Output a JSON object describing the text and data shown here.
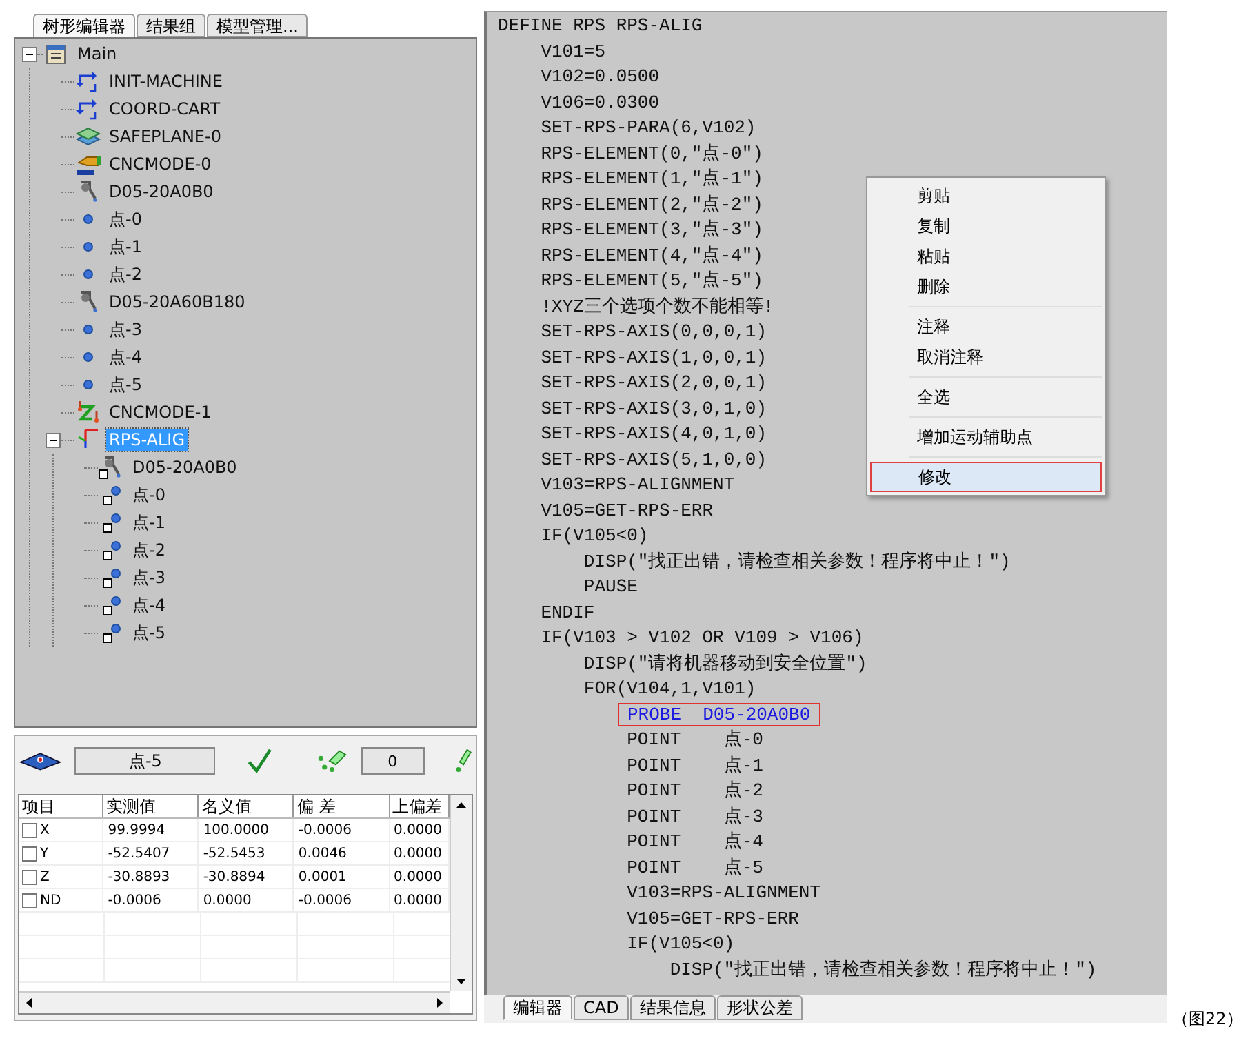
{
  "left_tabs": [
    {
      "label": "树形编辑器",
      "selected": true
    },
    {
      "label": "结果组",
      "selected": false
    },
    {
      "label": "模型管理...",
      "selected": false
    }
  ],
  "tree": [
    {
      "label": "Main",
      "kind": "program",
      "expanded": true,
      "selected": false,
      "children": [
        {
          "label": "INIT-MACHINE",
          "kind": "coord",
          "selected": false
        },
        {
          "label": "COORD-CART",
          "kind": "coord",
          "selected": false
        },
        {
          "label": "SAFEPLANE-0",
          "kind": "safeplane",
          "selected": false
        },
        {
          "label": "CNCMODE-0",
          "kind": "manual",
          "selected": false
        },
        {
          "label": "D05-20A0B0",
          "kind": "probe",
          "selected": false
        },
        {
          "label": "点-0",
          "kind": "point",
          "selected": false
        },
        {
          "label": "点-1",
          "kind": "point",
          "selected": false
        },
        {
          "label": "点-2",
          "kind": "point",
          "selected": false
        },
        {
          "label": "D05-20A60B180",
          "kind": "probe",
          "selected": false
        },
        {
          "label": "点-3",
          "kind": "point",
          "selected": false
        },
        {
          "label": "点-4",
          "kind": "point",
          "selected": false
        },
        {
          "label": "点-5",
          "kind": "point",
          "selected": false
        },
        {
          "label": "CNCMODE-1",
          "kind": "auto",
          "selected": false
        },
        {
          "label": "RPS-ALIG",
          "kind": "rps",
          "expanded": true,
          "selected": true,
          "children": [
            {
              "label": "D05-20A0B0",
              "kind": "probe-link",
              "selected": false
            },
            {
              "label": "点-0",
              "kind": "point-link",
              "selected": false
            },
            {
              "label": "点-1",
              "kind": "point-link",
              "selected": false
            },
            {
              "label": "点-2",
              "kind": "point-link",
              "selected": false
            },
            {
              "label": "点-3",
              "kind": "point-link",
              "selected": false
            },
            {
              "label": "点-4",
              "kind": "point-link",
              "selected": false
            },
            {
              "label": "点-5",
              "kind": "point-link",
              "selected": false
            }
          ]
        }
      ]
    }
  ],
  "feature_bar": {
    "feature": "点-5",
    "count": "0"
  },
  "table": {
    "columns": [
      "项目",
      "实测值",
      "名义值",
      "偏 差",
      "上偏差"
    ],
    "rows": [
      {
        "checked": false,
        "cells": [
          "X",
          "99.9994",
          "100.0000",
          "-0.0006",
          "0.0000"
        ]
      },
      {
        "checked": false,
        "cells": [
          "Y",
          "-52.5407",
          "-52.5453",
          "0.0046",
          "0.0000"
        ]
      },
      {
        "checked": false,
        "cells": [
          "Z",
          "-30.8893",
          "-30.8894",
          "0.0001",
          "0.0000"
        ]
      },
      {
        "checked": false,
        "cells": [
          "ND",
          "-0.0006",
          "0.0000",
          "-0.0006",
          "0.0000"
        ]
      }
    ]
  },
  "code": [
    {
      "text": "DEFINE RPS RPS-ALIG",
      "kind": "plain"
    },
    {
      "text": "    V101=5",
      "kind": "plain"
    },
    {
      "text": "    V102=0.0500",
      "kind": "plain"
    },
    {
      "text": "    V106=0.0300",
      "kind": "plain"
    },
    {
      "text": "    SET-RPS-PARA(6,V102)",
      "kind": "plain"
    },
    {
      "text": "    RPS-ELEMENT(0,″点-0″)",
      "kind": "plain"
    },
    {
      "text": "    RPS-ELEMENT(1,″点-1″)",
      "kind": "plain"
    },
    {
      "text": "    RPS-ELEMENT(2,″点-2″)",
      "kind": "plain"
    },
    {
      "text": "    RPS-ELEMENT(3,″点-3″)",
      "kind": "plain"
    },
    {
      "text": "    RPS-ELEMENT(4,″点-4″)",
      "kind": "plain"
    },
    {
      "text": "    RPS-ELEMENT(5,″点-5″)",
      "kind": "plain"
    },
    {
      "text": "    !XYZ三个选项个数不能相等!",
      "kind": "plain"
    },
    {
      "text": "    SET-RPS-AXIS(0,0,0,1)",
      "kind": "plain"
    },
    {
      "text": "    SET-RPS-AXIS(1,0,0,1)",
      "kind": "plain"
    },
    {
      "text": "    SET-RPS-AXIS(2,0,0,1)",
      "kind": "plain"
    },
    {
      "text": "    SET-RPS-AXIS(3,0,1,0)",
      "kind": "plain"
    },
    {
      "text": "    SET-RPS-AXIS(4,0,1,0)",
      "kind": "plain"
    },
    {
      "text": "    SET-RPS-AXIS(5,1,0,0)",
      "kind": "plain"
    },
    {
      "text": "    V103=RPS-ALIGNMENT",
      "kind": "plain"
    },
    {
      "text": "    V105=GET-RPS-ERR",
      "kind": "plain"
    },
    {
      "text": "    IF(V105<0)",
      "kind": "plain"
    },
    {
      "text": "        DISP(″找正出错，请检查相关参数！程序将中止！″)",
      "kind": "plain"
    },
    {
      "text": "        PAUSE",
      "kind": "plain"
    },
    {
      "text": "    ENDIF",
      "kind": "plain"
    },
    {
      "text": "    IF(V103 > V102 OR V109 > V106)",
      "kind": "plain"
    },
    {
      "text": "        DISP(″请将机器移动到安全位置″)",
      "kind": "plain"
    },
    {
      "text": "        FOR(V104,1,V101)",
      "kind": "plain"
    },
    {
      "text": "PROBE  D05-20A0B0",
      "kind": "highlight"
    },
    {
      "text": "            POINT    点-0",
      "kind": "plain"
    },
    {
      "text": "            POINT    点-1",
      "kind": "plain"
    },
    {
      "text": "            POINT    点-2",
      "kind": "plain"
    },
    {
      "text": "            POINT    点-3",
      "kind": "plain"
    },
    {
      "text": "            POINT    点-4",
      "kind": "plain"
    },
    {
      "text": "            POINT    点-5",
      "kind": "plain"
    },
    {
      "text": "            V103=RPS-ALIGNMENT",
      "kind": "plain"
    },
    {
      "text": "            V105=GET-RPS-ERR",
      "kind": "plain"
    },
    {
      "text": "            IF(V105<0)",
      "kind": "plain"
    },
    {
      "text": "                DISP(″找正出错，请检查相关参数！程序将中止！″)",
      "kind": "plain"
    }
  ],
  "context_menu": [
    [
      {
        "label": "剪贴",
        "selected": false
      },
      {
        "label": "复制",
        "selected": false
      },
      {
        "label": "粘贴",
        "selected": false
      },
      {
        "label": "删除",
        "selected": false
      }
    ],
    [
      {
        "label": "注释",
        "selected": false
      },
      {
        "label": "取消注释",
        "selected": false
      }
    ],
    [
      {
        "label": "全选",
        "selected": false
      }
    ],
    [
      {
        "label": "增加运动辅助点",
        "selected": false
      }
    ],
    [
      {
        "label": "修改",
        "selected": true
      }
    ]
  ],
  "bottom_tabs": [
    {
      "label": "编辑器",
      "selected": true
    },
    {
      "label": "CAD",
      "selected": false
    },
    {
      "label": "结果信息",
      "selected": false
    },
    {
      "label": "形状公差",
      "selected": false
    }
  ],
  "caption": "（图22）"
}
